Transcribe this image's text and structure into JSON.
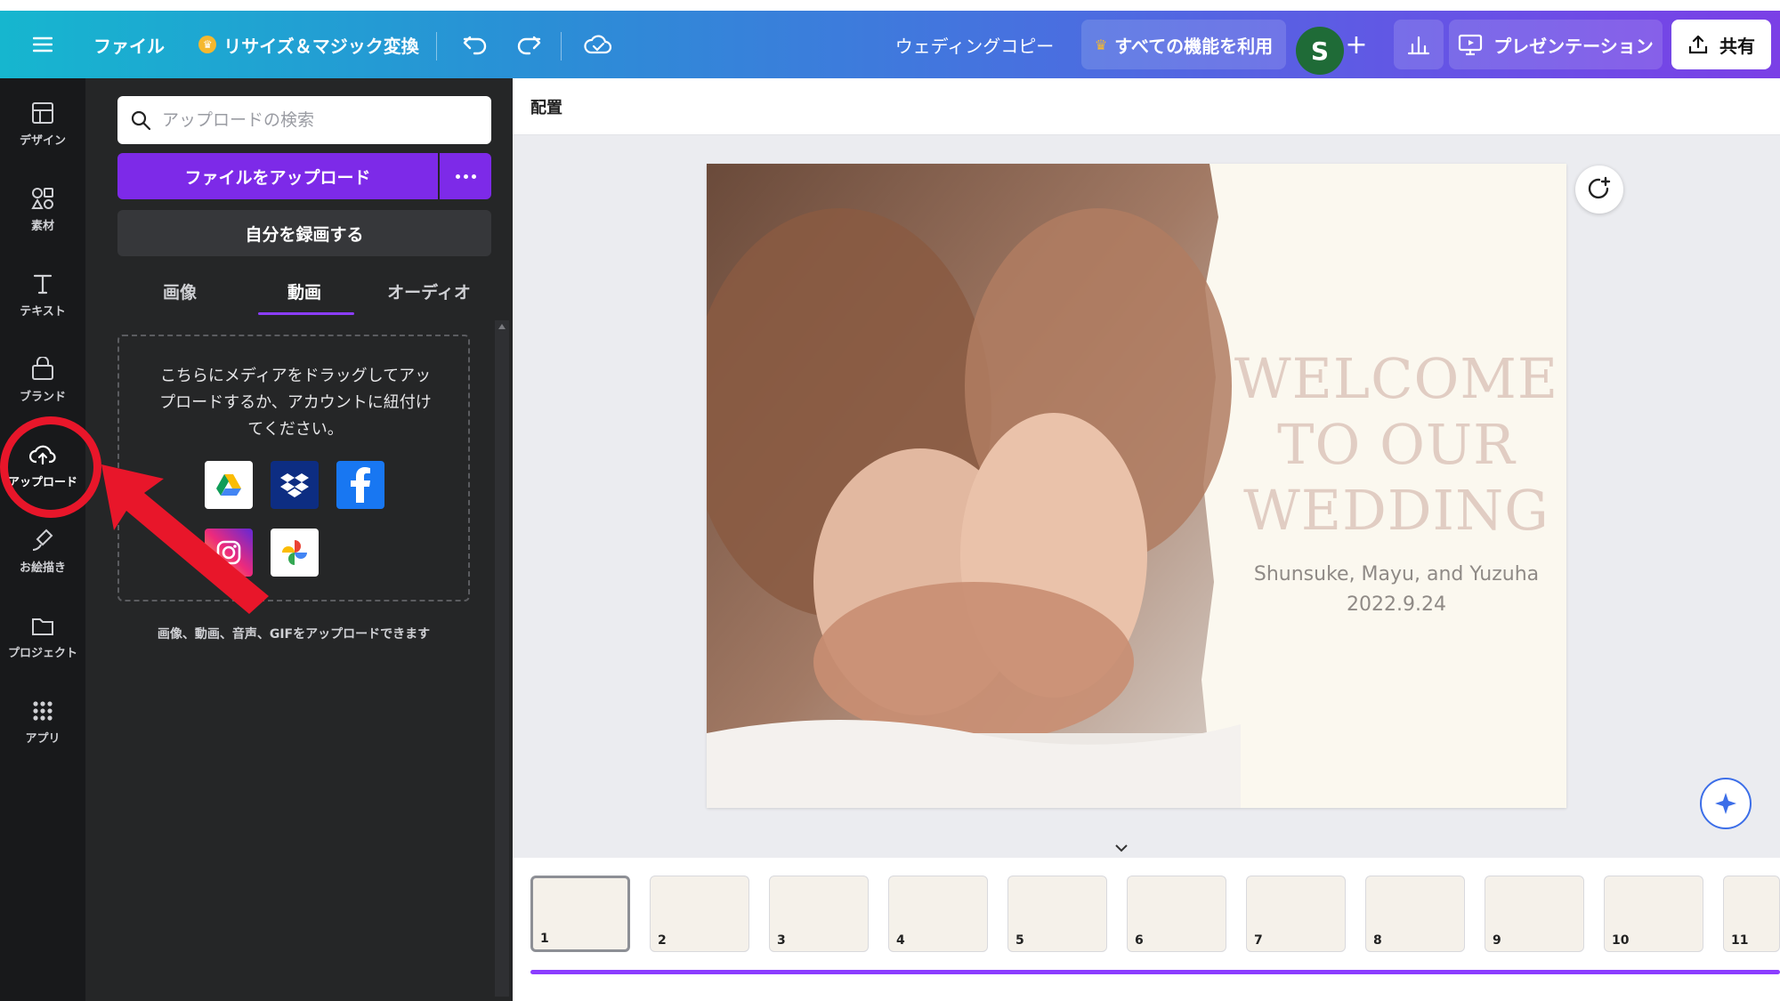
{
  "header": {
    "file_label": "ファイル",
    "resize_label": "リサイズ＆マジック変換",
    "doc_title": "ウェディングコピー",
    "pro_label": "すべての機能を利用",
    "avatar_initial": "S",
    "plus_label": "+",
    "present_label": "プレゼンテーション",
    "share_label": "共有"
  },
  "rail": {
    "items": [
      {
        "label": "デザイン",
        "icon": "layout-icon"
      },
      {
        "label": "素材",
        "icon": "shapes-icon"
      },
      {
        "label": "テキスト",
        "icon": "text-icon"
      },
      {
        "label": "ブランド",
        "icon": "brand-icon"
      },
      {
        "label": "アップロード",
        "icon": "cloud-upload-icon"
      },
      {
        "label": "お絵描き",
        "icon": "draw-icon"
      },
      {
        "label": "プロジェクト",
        "icon": "folder-icon"
      },
      {
        "label": "アプリ",
        "icon": "apps-grid-icon"
      }
    ]
  },
  "panel": {
    "search_placeholder": "アップロードの検索",
    "upload_button": "ファイルをアップロード",
    "record_button": "自分を録画する",
    "tabs": [
      "画像",
      "動画",
      "オーディオ"
    ],
    "active_tab": "動画",
    "drop_text": "こちらにメディアをドラッグしてアップロードするか、アカウントに紐付けてください。",
    "sources": [
      "google-drive-icon",
      "dropbox-icon",
      "facebook-icon",
      "instagram-icon",
      "google-photos-icon"
    ],
    "upload_note": "画像、動画、音声、GIFをアップロードできます"
  },
  "context_bar": {
    "label": "配置"
  },
  "slide": {
    "welcome_lines": [
      "WELCOME",
      "TO OUR",
      "WEDDING"
    ],
    "names": "Shunsuke, Mayu, and Yuzuha",
    "date": "2022.9.24"
  },
  "thumbnails": {
    "pages": [
      "1",
      "2",
      "3",
      "4",
      "5",
      "6",
      "7",
      "8",
      "9",
      "10",
      "11"
    ],
    "selected": "1"
  },
  "colors": {
    "accent": "#7d2ae8",
    "highlight": "#e8162a",
    "title_blush": "#e1cdc3"
  }
}
